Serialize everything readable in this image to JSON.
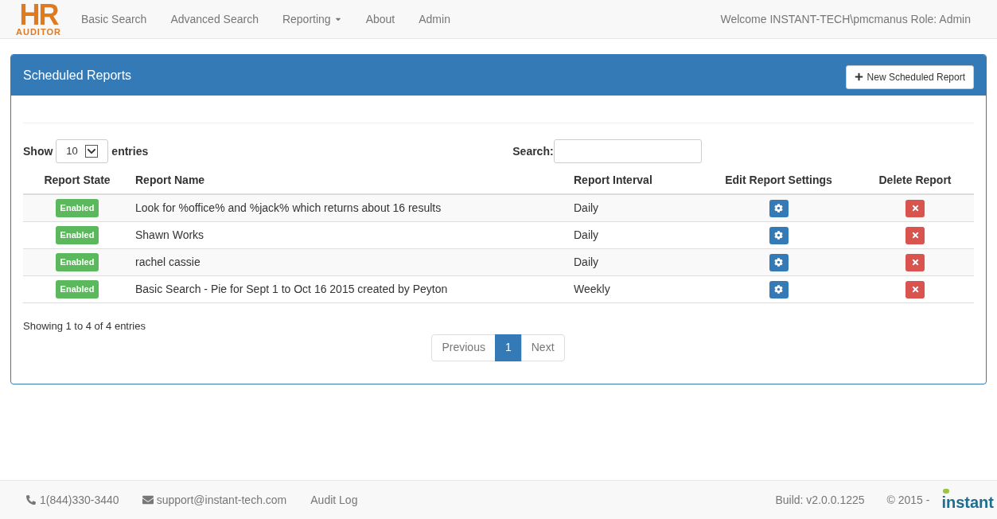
{
  "logo": {
    "mark": "HR",
    "word": "AUDITOR"
  },
  "nav": [
    {
      "label": "Basic Search",
      "dropdown": false
    },
    {
      "label": "Advanced Search",
      "dropdown": false
    },
    {
      "label": "Reporting",
      "dropdown": true
    },
    {
      "label": "About",
      "dropdown": false
    },
    {
      "label": "Admin",
      "dropdown": false
    }
  ],
  "welcome": "Welcome INSTANT-TECH\\pmcmanus Role: Admin",
  "panel": {
    "title": "Scheduled Reports",
    "new_button": "New Scheduled Report"
  },
  "length": {
    "before": "Show",
    "value": "10",
    "after": "entries"
  },
  "search": {
    "label": "Search:"
  },
  "table": {
    "columns": [
      "Report State",
      "Report Name",
      "Report Interval",
      "Edit Report Settings",
      "Delete Report"
    ],
    "rows": [
      {
        "state": "Enabled",
        "enabled": true,
        "name": "Look for %office% and %jack% which returns about 16 results",
        "interval": "Daily"
      },
      {
        "state": "Enabled",
        "enabled": true,
        "name": "Shawn Works",
        "interval": "Daily"
      },
      {
        "state": "Enabled",
        "enabled": true,
        "name": "rachel cassie",
        "interval": "Daily"
      },
      {
        "state": "Enabled",
        "enabled": true,
        "name": "Basic Search - Pie for Sept 1 to Oct 16 2015 created by Peyton",
        "interval": "Weekly"
      }
    ]
  },
  "info": "Showing 1 to 4 of 4 entries",
  "pagination": [
    {
      "label": "Previous",
      "selected": false
    },
    {
      "label": "1",
      "selected": true
    },
    {
      "label": "Next",
      "selected": false
    }
  ],
  "footer": {
    "phone": "1(844)330-3440",
    "email": "support@instant-tech.com",
    "audit": "Audit Log",
    "build": "Build: v2.0.0.1225",
    "copyright": "© 2015 -",
    "brand": "instant"
  }
}
